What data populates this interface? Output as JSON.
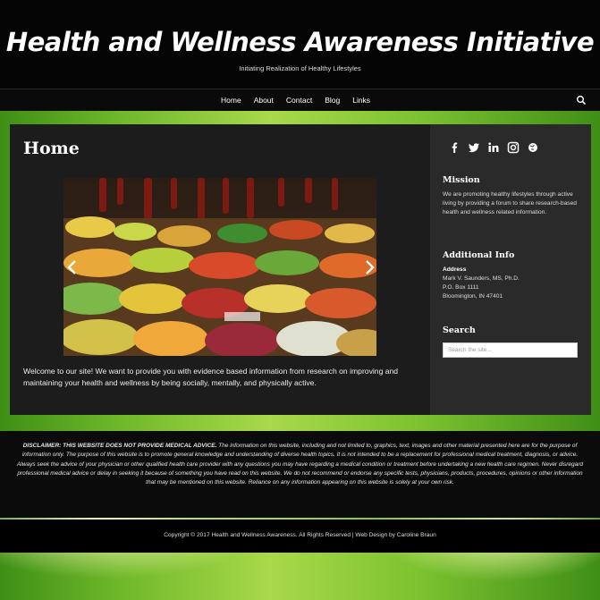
{
  "site": {
    "title": "Health and Wellness Awareness Initiative",
    "tagline": "Initiating Realization of Healthy Lifestyles"
  },
  "nav": {
    "items": [
      "Home",
      "About",
      "Contact",
      "Blog",
      "Links"
    ],
    "search_icon": "search-icon"
  },
  "main": {
    "page_title": "Home",
    "slider": {
      "image": "fruit and vegetable market stall",
      "prev_icon": "chevron-left-icon",
      "next_icon": "chevron-right-icon"
    },
    "welcome": "Welcome to our site!  We want to provide you with evidence based information from research on improving and maintaining your health and wellness by being socially, mentally, and physically active."
  },
  "sidebar": {
    "social_icons": [
      "facebook-icon",
      "twitter-icon",
      "linkedin-icon",
      "instagram-icon",
      "globe-icon"
    ],
    "mission_title": "Mission",
    "mission_text": "We are promoting healthy lifestyles through active living by providing a forum to share research-based  health and wellness related information.",
    "info_title": "Additional Info",
    "address_label": "Address",
    "address_lines": [
      "Mark V. Saunders, MS, Ph.D.",
      "P.O. Box 1111",
      "Bloomington, IN 47401"
    ],
    "search_title": "Search",
    "search_placeholder": "Search the site..."
  },
  "footer": {
    "disclaimer_lead": "DISCLAIMER: THIS WEBSITE DOES NOT PROVIDE MEDICAL ADVICE.",
    "disclaimer_body": " The information on this website, including and not limited to, graphics, text, images and other material presented here are for the purpose of information only. The purpose of this website is to promote general knowledge and understanding of diverse health topics. It is not intended to be a replacement for professional medical treatment, diagnosis, or advice. Always seek the advice of your physician or other qualified health care provider with any questions you may have regarding a medical condition or treatment before undertaking a new health care regimen. Never disregard professional medical advice or delay in seeking it because of something you have read on this website. We do not recommend or endorse any specific tests, physicians, products, procedures, opinions or other information that may be mentioned on this website. Reliance on any information appearing on this website is solely at your own risk.",
    "copyright": "Copyright © 2017 Health and Wellness Awareness. All Rights Reserved | Web Design by Caroline Braun"
  },
  "colors": {
    "header_bg": "#050505",
    "panel_bg": "#1c1c1c",
    "sidebar_bg": "#2a2a2a",
    "page_green": "#6fb82a"
  }
}
